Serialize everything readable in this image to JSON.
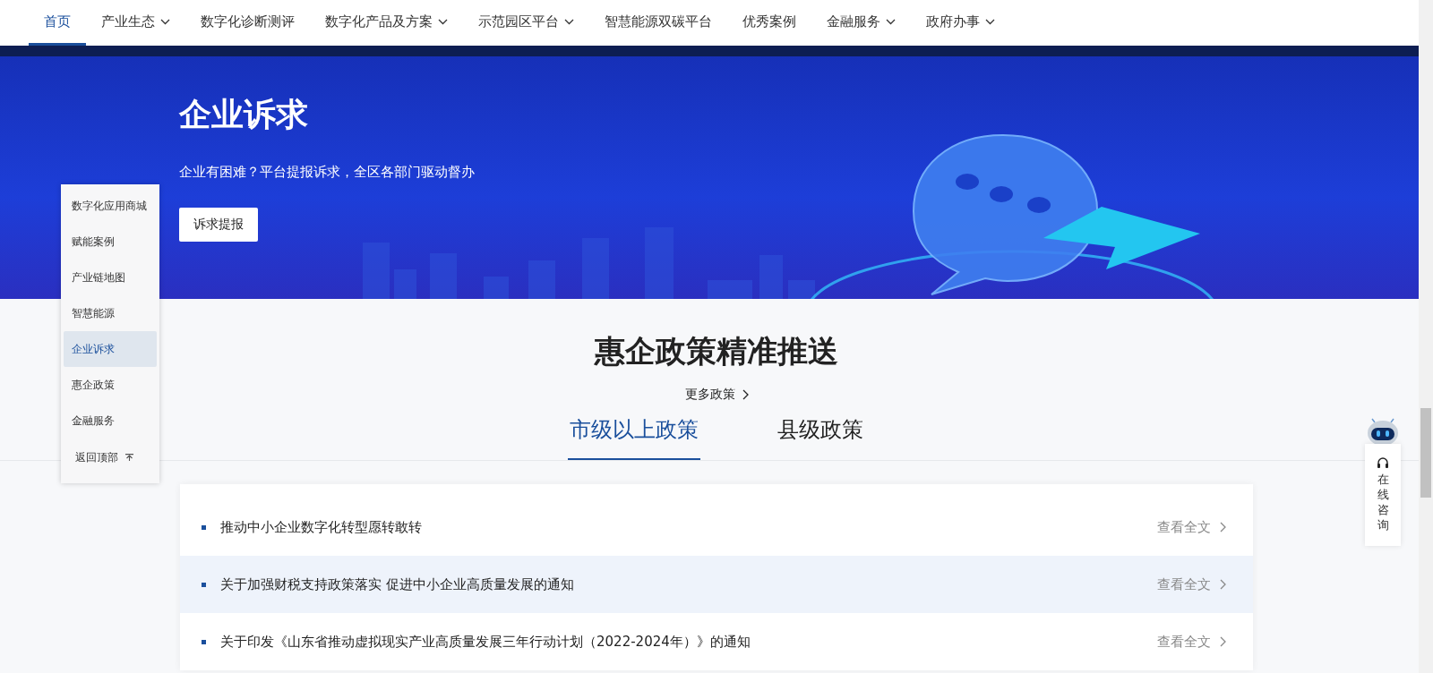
{
  "nav": {
    "items": [
      {
        "label": "首页",
        "selected": true,
        "dropdown": false
      },
      {
        "label": "产业生态",
        "selected": false,
        "dropdown": true
      },
      {
        "label": "数字化诊断测评",
        "selected": false,
        "dropdown": false
      },
      {
        "label": "数字化产品及方案",
        "selected": false,
        "dropdown": true
      },
      {
        "label": "示范园区平台",
        "selected": false,
        "dropdown": true
      },
      {
        "label": "智慧能源双碳平台",
        "selected": false,
        "dropdown": false
      },
      {
        "label": "优秀案例",
        "selected": false,
        "dropdown": false
      },
      {
        "label": "金融服务",
        "selected": false,
        "dropdown": true
      },
      {
        "label": "政府办事",
        "selected": false,
        "dropdown": true
      }
    ]
  },
  "banner": {
    "title": "企业诉求",
    "subtitle": "企业有困难？平台提报诉求，全区各部门驱动督办",
    "button": "诉求提报"
  },
  "side_menu": {
    "items": [
      {
        "label": "数字化应用商城",
        "selected": false
      },
      {
        "label": "赋能案例",
        "selected": false
      },
      {
        "label": "产业链地图",
        "selected": false
      },
      {
        "label": "智慧能源",
        "selected": false
      },
      {
        "label": "企业诉求",
        "selected": true
      },
      {
        "label": "惠企政策",
        "selected": false
      },
      {
        "label": "金融服务",
        "selected": false
      }
    ],
    "back_to_top": "返回顶部"
  },
  "policy": {
    "title": "惠企政策精准推送",
    "more_link": "更多政策",
    "tabs": [
      {
        "label": "市级以上政策",
        "selected": true
      },
      {
        "label": "县级政策",
        "selected": false
      }
    ],
    "rows": [
      {
        "title": "推动中小企业数字化转型愿转敢转",
        "link": "查看全文",
        "selected": false
      },
      {
        "title": "关于加强财税支持政策落实 促进中小企业高质量发展的通知",
        "link": "查看全文",
        "selected": true
      },
      {
        "title": "关于印发《山东省推动虚拟现实产业高质量发展三年行动计划（2022-2024年）》的通知",
        "link": "查看全文",
        "selected": false
      }
    ]
  },
  "consult": {
    "label": "在线咨询"
  }
}
